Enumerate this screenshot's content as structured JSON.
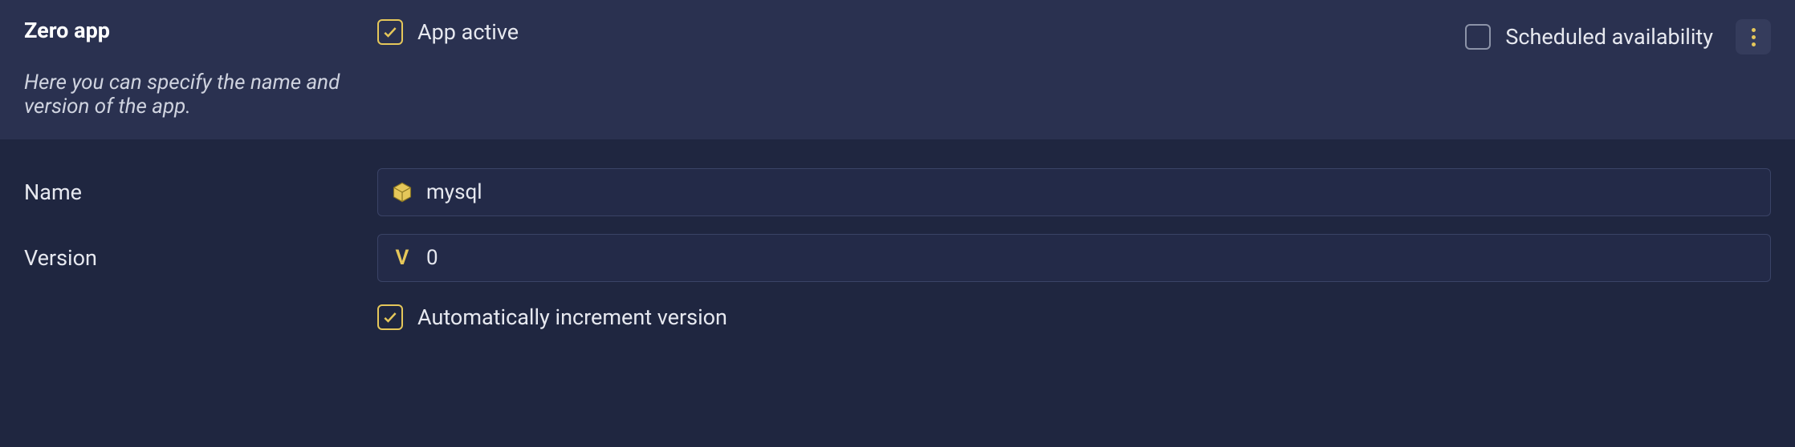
{
  "header": {
    "title": "Zero app",
    "subtitle": "Here you can specify the name and version of the app.",
    "app_active_label": "App active",
    "scheduled_label": "Scheduled availability"
  },
  "form": {
    "name_label": "Name",
    "name_value": "mysql",
    "version_label": "Version",
    "version_value": "0",
    "auto_inc_label": "Automatically increment version"
  },
  "checkboxes": {
    "app_active": true,
    "scheduled": false,
    "auto_inc": true
  },
  "icons": {
    "package": "package-icon",
    "version_letter": "V"
  }
}
